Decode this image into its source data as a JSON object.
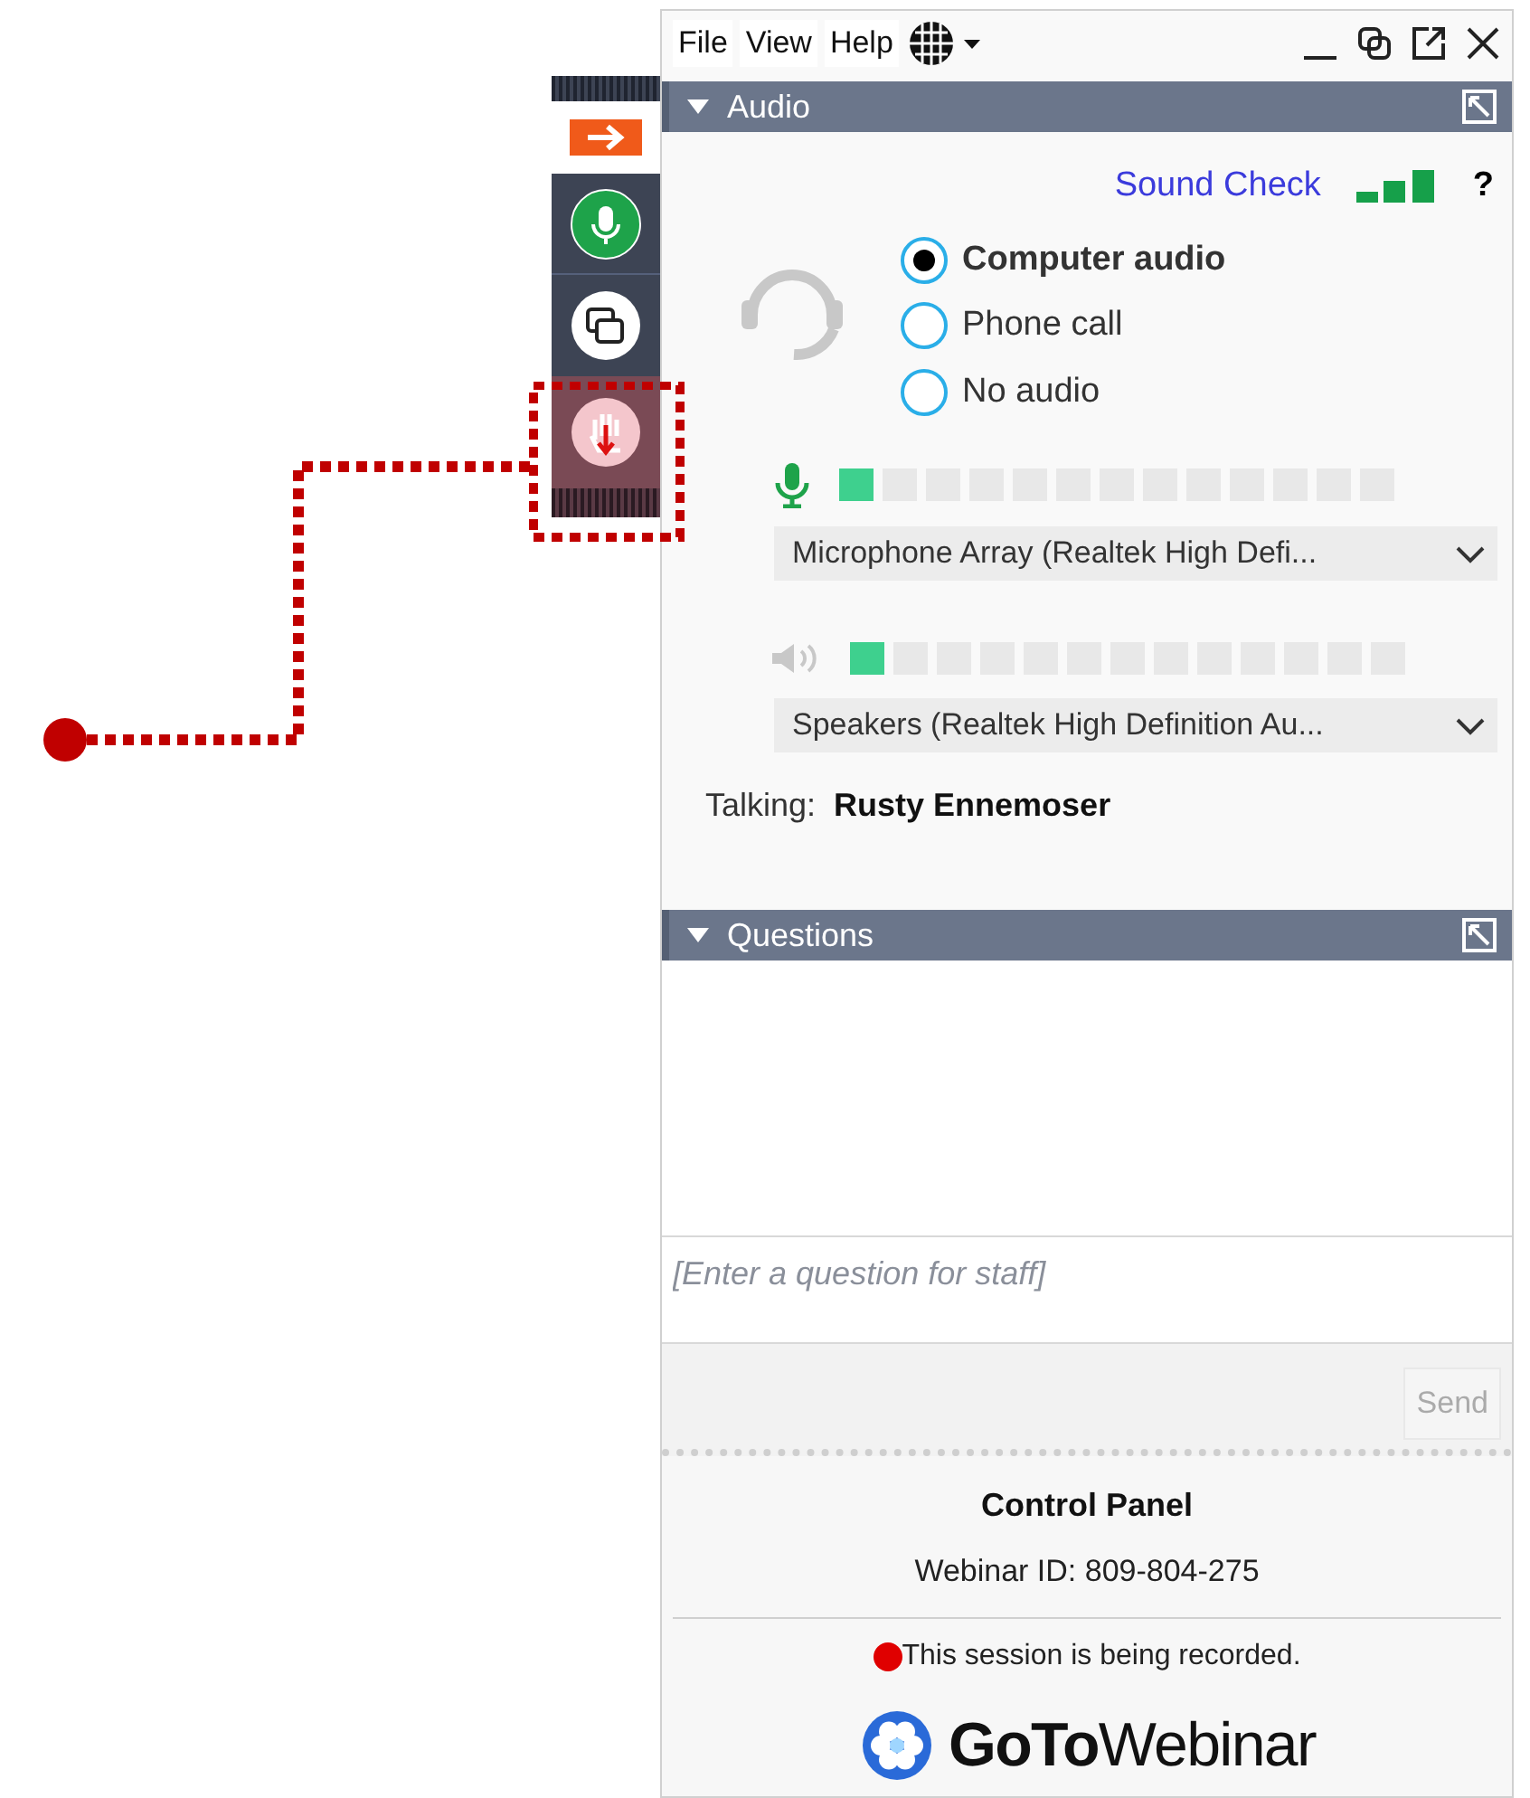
{
  "menu": [
    "File",
    "View",
    "Help"
  ],
  "audio": {
    "title": "Audio",
    "sound_check": "Sound Check",
    "help": "?",
    "options": [
      {
        "label": "Computer audio",
        "selected": true
      },
      {
        "label": "Phone call",
        "selected": false
      },
      {
        "label": "No audio",
        "selected": false
      }
    ],
    "microphone": {
      "level": 0.077,
      "device": "Microphone Array (Realtek High Defi..."
    },
    "speakers": {
      "level": 0.077,
      "device": "Speakers (Realtek High Definition Au..."
    },
    "talking_label": "Talking:",
    "talking_name": "Rusty Ennemoser"
  },
  "questions": {
    "title": "Questions",
    "placeholder": "[Enter a question for staff]",
    "send": "Send"
  },
  "footer": {
    "title": "Control Panel",
    "webinar_id": "Webinar ID: 809-804-275",
    "recording": "This session is being recorded.",
    "logo": "**GoTo**Webinar"
  }
}
